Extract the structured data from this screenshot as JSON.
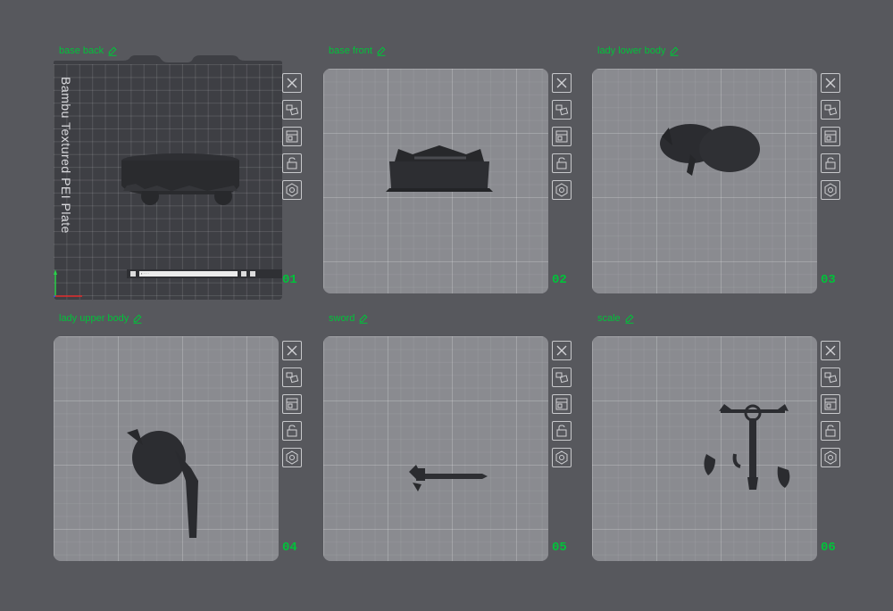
{
  "plates": [
    {
      "name": "base back",
      "number": "01",
      "plate_label": "Bambu Textured PEI Plate",
      "status_text": "▪ · · ·",
      "textured": true
    },
    {
      "name": "base front",
      "number": "02",
      "textured": false
    },
    {
      "name": "lady lower body",
      "number": "03",
      "textured": false
    },
    {
      "name": "lady upper body",
      "number": "04",
      "textured": false
    },
    {
      "name": "sword",
      "number": "05",
      "textured": false
    },
    {
      "name": "scale",
      "number": "06",
      "textured": false
    }
  ],
  "toolbar_icons": [
    "close-icon",
    "auto-arrange-icon",
    "orient-icon",
    "lock-icon",
    "settings-icon"
  ],
  "colors": {
    "accent": "#00c23a",
    "background": "#57585d",
    "plate": "#8a8b90",
    "plate_textured": "#3e3f44",
    "model": "#2e2f33"
  }
}
